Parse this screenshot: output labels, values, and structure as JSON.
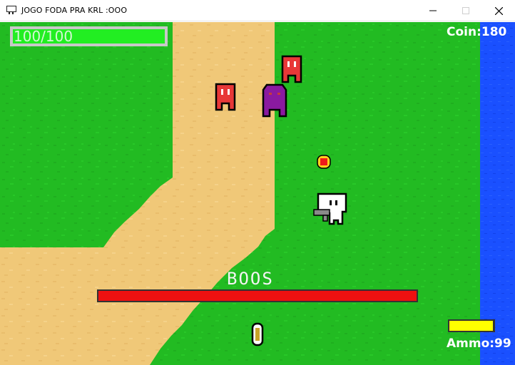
{
  "window": {
    "title": "JOGO FODA PRA KRL :OOO"
  },
  "hud": {
    "health_text": "100/100",
    "health_fraction": 1.0,
    "coin_text": "Coin:180",
    "ammo_text": "Ammo:99",
    "ammo_fraction": 0.99
  },
  "boss": {
    "label": "BOOS",
    "health_fraction": 1.0
  },
  "colors": {
    "grass": "#22bb22",
    "sand": "#f0c878",
    "water": "#1a50ff",
    "health_green": "#22ee22",
    "boss_bar": "#ee1111",
    "ammo_bar": "#ffff00",
    "enemy_red": "#e83838",
    "boss_purple": "#8a1aa0"
  },
  "icons": {
    "app": "app-window-icon",
    "minimize": "minimize-icon",
    "maximize": "maximize-icon",
    "close": "close-icon"
  }
}
